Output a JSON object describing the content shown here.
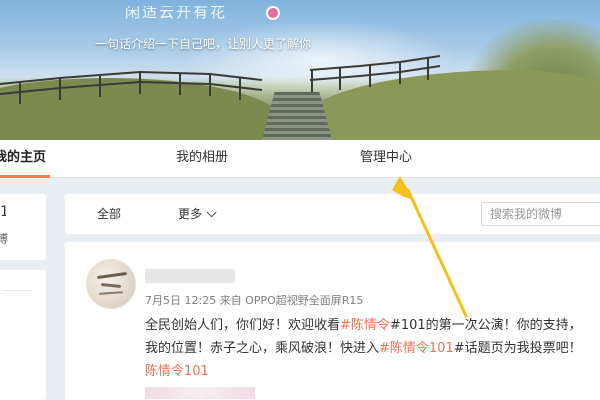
{
  "cover": {
    "nickname": "闲适云开有花",
    "intro": "一句话介绍一下自己吧，让别人更了解你"
  },
  "tabs": [
    {
      "label": "我的主页",
      "active": true
    },
    {
      "label": "我的相册",
      "active": false
    },
    {
      "label": "管理中心",
      "active": false
    }
  ],
  "left_card": {
    "label": "博"
  },
  "filter_bar": {
    "all_label": "全部",
    "more_label": "更多",
    "search_placeholder": "搜索我的微博"
  },
  "feed": {
    "meta": "7月5日 12:25 来自 OPPO超视野全面屏R15",
    "line1_pre": "全民创始人们，你们好！欢迎收看",
    "line1_tag": "#陈情令",
    "line1_post": "#101的第一次公演！你的支持，",
    "line2_pre": "我的位置！赤子之心，乘风破浪！快进入",
    "line2_tag": "#陈情令101",
    "line2_post": "#话题页为我投票吧！",
    "line3_tag": "陈情令101"
  },
  "colors": {
    "accent": "#fa7d3c",
    "link": "#eb7350",
    "annotation_arrow": "#f2c11a"
  }
}
